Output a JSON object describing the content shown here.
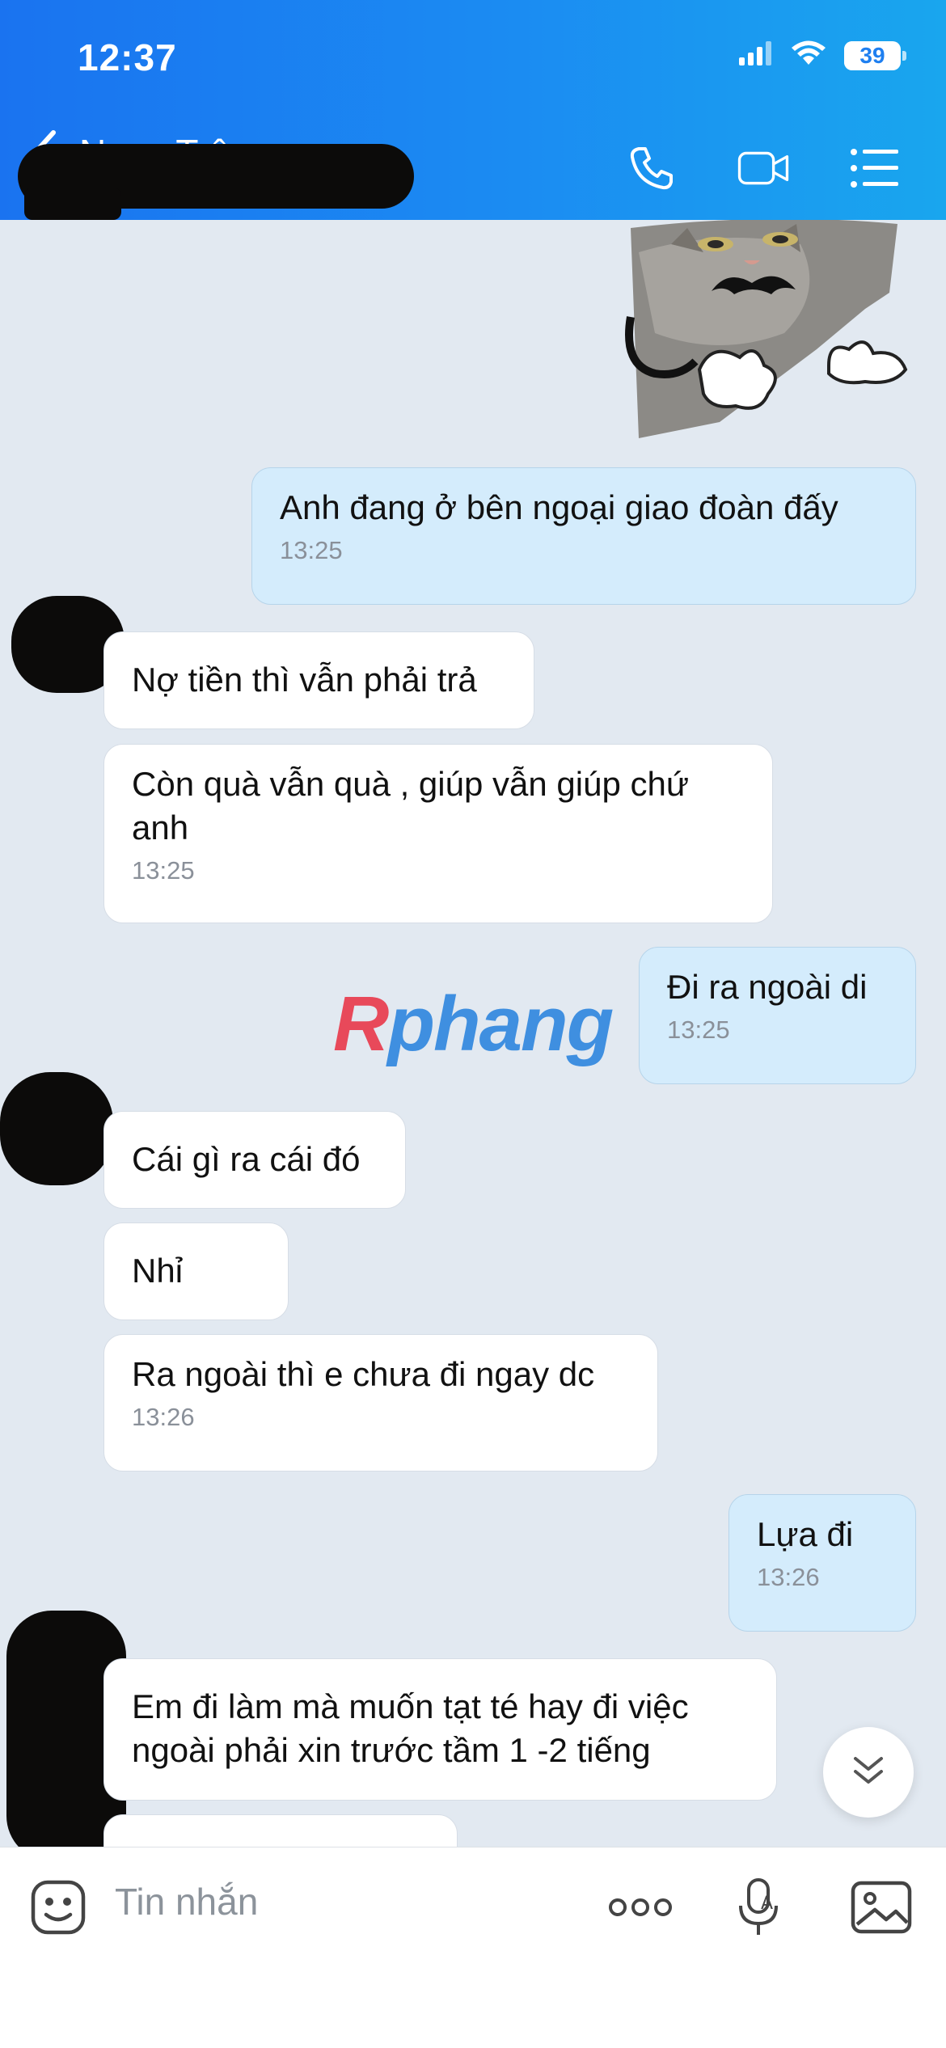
{
  "status_bar": {
    "time": "12:37",
    "battery": "39",
    "battery_level": 0.39,
    "icons": [
      "signal-icon",
      "wifi-icon",
      "battery-icon"
    ]
  },
  "header": {
    "contact_name": "Ngọc Trâm",
    "actions": [
      "phone-icon",
      "video-call-icon",
      "menu-list-icon"
    ]
  },
  "messages": [
    {
      "dir": "out",
      "type": "sticker",
      "label": "cat-mustache-sticker"
    },
    {
      "dir": "out",
      "text": "Anh đang ở bên ngoại giao đoàn đấy",
      "time": "13:25"
    },
    {
      "dir": "in",
      "text": "Nợ tiền thì vẫn phải trả",
      "time": ""
    },
    {
      "dir": "in",
      "text": "Còn quà vẫn quà , giúp vẫn giúp chứ anh",
      "time": "13:25"
    },
    {
      "dir": "out",
      "text": "Đi ra ngoài di",
      "time": "13:25"
    },
    {
      "dir": "in",
      "text": "Cái gì ra cái đó",
      "time": ""
    },
    {
      "dir": "in",
      "text": "Nhỉ",
      "time": ""
    },
    {
      "dir": "in",
      "text": "Ra ngoài thì e chưa đi ngay dc",
      "time": "13:26"
    },
    {
      "dir": "out",
      "text": "Lựa đi",
      "time": "13:26"
    },
    {
      "dir": "in",
      "text": "Em đi làm mà muốn tạt té hay đi việc ngoài phải xin trước tầm 1 -2 tiếng",
      "time": ""
    },
    {
      "dir": "in",
      "text": "",
      "time": ""
    }
  ],
  "watermark": {
    "first": "R",
    "rest": "phang"
  },
  "composer": {
    "placeholder": "Tin nhắn",
    "icons": [
      "sticker-icon",
      "more-icon",
      "voice-icon",
      "image-icon"
    ]
  },
  "colors": {
    "header_gradient_start": "#1a73f0",
    "header_gradient_end": "#19a6ee",
    "chat_background": "#e2e9f1",
    "outgoing_bubble": "#d4ecfc",
    "incoming_bubble": "#ffffff"
  }
}
